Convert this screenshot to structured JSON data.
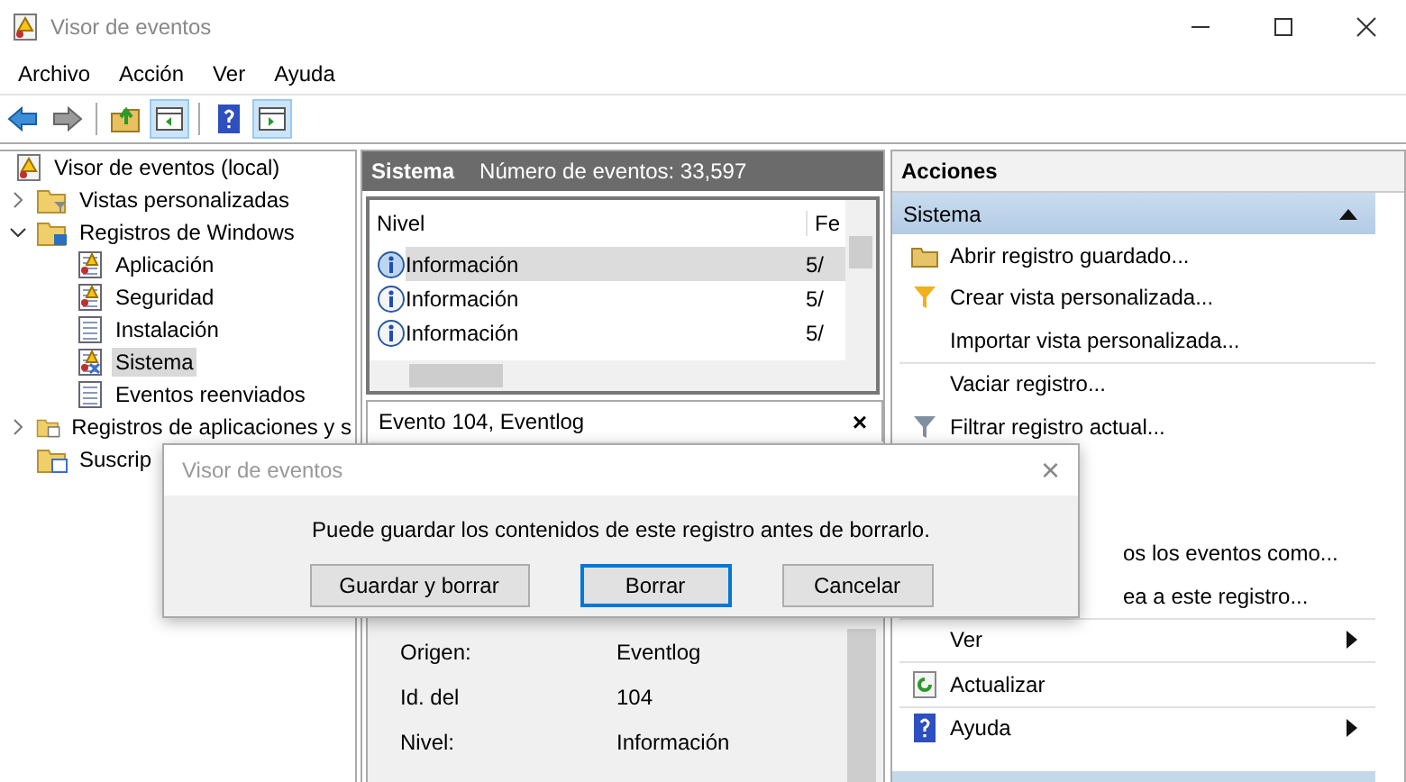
{
  "window": {
    "title": "Visor de eventos"
  },
  "menu": [
    "Archivo",
    "Acción",
    "Ver",
    "Ayuda"
  ],
  "toolbar": [
    {
      "kind": "back",
      "on": false
    },
    {
      "kind": "forward",
      "on": false
    },
    {
      "kind": "up",
      "on": false
    },
    {
      "kind": "panel-left",
      "on": true
    },
    {
      "kind": "help",
      "on": false
    },
    {
      "kind": "panel-right",
      "on": true
    }
  ],
  "tree": {
    "label": "Visor de eventos (local)",
    "children": [
      {
        "label": "Vistas personalizadas",
        "kind": "filter-folder",
        "expanded": false,
        "selected": false
      },
      {
        "label": "Registros de Windows",
        "kind": "log-folder",
        "expanded": true,
        "selected": false,
        "children": [
          {
            "label": "Aplicación",
            "kind": "log",
            "selected": false
          },
          {
            "label": "Seguridad",
            "kind": "log",
            "selected": false
          },
          {
            "label": "Instalación",
            "kind": "log-plain",
            "selected": false
          },
          {
            "label": "Sistema",
            "kind": "log-x",
            "selected": true
          },
          {
            "label": "Eventos reenviados",
            "kind": "log-plain",
            "selected": false
          }
        ]
      },
      {
        "label": "Registros de aplicaciones y s",
        "kind": "folder",
        "expanded": false,
        "selected": false
      },
      {
        "label": "Suscrip",
        "kind": "sub-folder",
        "selected": false
      }
    ]
  },
  "events": {
    "title": "Sistema",
    "count": "Número de eventos: 33,597",
    "columns": [
      "Nivel",
      "Fe"
    ],
    "rows": [
      {
        "level": "Información",
        "date": "5/",
        "selected": true
      },
      {
        "level": "Información",
        "date": "5/",
        "selected": false
      },
      {
        "level": "Información",
        "date": "5/",
        "selected": false
      }
    ]
  },
  "event_detail": {
    "title": "Evento 104, Eventlog",
    "close": "×",
    "fields": [
      {
        "label": "Origen:",
        "value": "Eventlog"
      },
      {
        "label": "Id. del",
        "value": "104"
      },
      {
        "label": "Nivel:",
        "value": "Información"
      }
    ]
  },
  "actions": {
    "title": "Acciones",
    "section": {
      "title": "Sistema",
      "expanded": true
    },
    "groups": [
      [
        {
          "label": "Abrir registro guardado...",
          "kind": "open"
        },
        {
          "label": "Crear vista personalizada...",
          "kind": "filter"
        },
        {
          "label": "Importar vista personalizada...",
          "kind": "plain"
        }
      ],
      [
        {
          "label": "Vaciar registro...",
          "kind": "plain"
        },
        {
          "label": "Filtrar registro actual...",
          "kind": "filter-log"
        },
        {
          "label": "os los eventos como...",
          "kind": "partial"
        },
        {
          "label": "ea a este registro...",
          "kind": "partial"
        }
      ],
      [
        {
          "label": "Ver",
          "kind": "submenu"
        }
      ],
      [
        {
          "label": "Actualizar",
          "kind": "refresh"
        }
      ],
      [
        {
          "label": "Ayuda",
          "kind": "help-submenu"
        }
      ]
    ]
  },
  "dialog": {
    "title": "Visor de eventos",
    "close": "×",
    "message": "Puede guardar los contenidos de este registro antes de borrarlo.",
    "buttons": [
      {
        "label": "Guardar y borrar",
        "selected": false
      },
      {
        "label": "Borrar",
        "selected": true
      },
      {
        "label": "Cancelar",
        "selected": false
      }
    ]
  }
}
